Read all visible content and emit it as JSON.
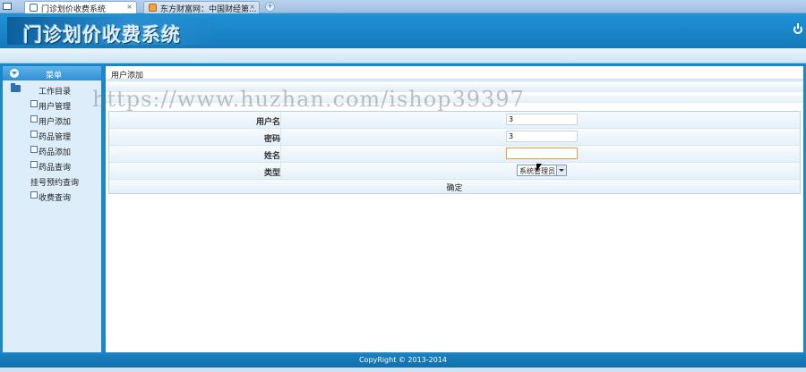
{
  "browser": {
    "tabs": [
      {
        "title": "门诊划价收费系统",
        "active": true
      },
      {
        "title": "东方财富网：中国财经第...",
        "active": false
      }
    ]
  },
  "header": {
    "logo_text": "门诊划价收费系统"
  },
  "sidebar": {
    "menu_title": "菜单",
    "root_label": "工作目录",
    "items": [
      {
        "label": "用户管理"
      },
      {
        "label": "用户添加"
      },
      {
        "label": "药品管理"
      },
      {
        "label": "药品添加"
      },
      {
        "label": "药品查询"
      },
      {
        "label": "挂号预约查询"
      },
      {
        "label": "收费查询"
      }
    ]
  },
  "content": {
    "breadcrumb": "用户添加",
    "form": {
      "username_label": "用户名",
      "username_value": "3",
      "password_label": "密码",
      "password_value": "3",
      "name_label": "姓名",
      "name_value": "",
      "type_label": "类型",
      "type_selected": "系统管理员",
      "submit_label": "确定"
    }
  },
  "footer": {
    "copyright": "CopyRight © 2013-2014"
  },
  "watermark": "https://www.huzhan.com/ishop39397"
}
